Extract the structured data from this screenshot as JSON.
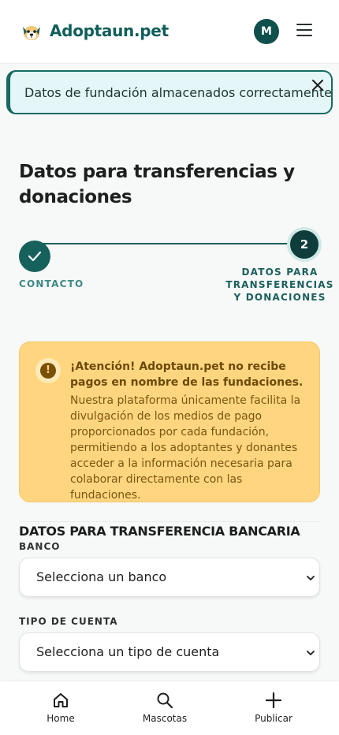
{
  "header": {
    "brand": "Adoptaun.pet",
    "avatar_initial": "M",
    "logo_icon": "dog-face-icon",
    "menu_icon": "hamburger-menu-icon"
  },
  "toast": {
    "message": "Datos de fundación almacenados correctamente",
    "close_icon": "close-icon"
  },
  "page": {
    "title": "Datos para transferencias y donaciones"
  },
  "stepper": {
    "steps": [
      {
        "label": "CONTACTO",
        "status": "completed"
      },
      {
        "number": "2",
        "label": "DATOS PARA TRANSFERENCIAS Y DONACIONES",
        "status": "current"
      }
    ]
  },
  "alert": {
    "icon": "warning-icon",
    "icon_glyph": "!",
    "title": "¡Atención! Adoptaun.pet no recibe pagos en nombre de las fundaciones.",
    "body": "Nuestra plataforma únicamente facilita la divulgación de los medios de pago proporcionados por cada fundación, permitiendo a los adoptantes y donantes acceder a la información necesaria para colaborar directamente con las fundaciones."
  },
  "bank_section": {
    "title": "DATOS PARA TRANSFERENCIA BANCARIA",
    "bank_label": "BANCO",
    "bank_value": "Selecciona un banco",
    "account_type_label": "TIPO DE CUENTA",
    "account_type_value": "Selecciona un tipo de cuenta"
  },
  "bottom_nav": {
    "items": [
      {
        "label": "Home",
        "icon": "home-icon"
      },
      {
        "label": "Mascotas",
        "icon": "search-icon"
      },
      {
        "label": "Publicar",
        "icon": "plus-icon"
      }
    ]
  },
  "colors": {
    "brand": "#115e5a",
    "toast_bg": "#e4f6f7",
    "alert_bg": "#ffd67f",
    "step_dark": "#0e3d3b"
  }
}
